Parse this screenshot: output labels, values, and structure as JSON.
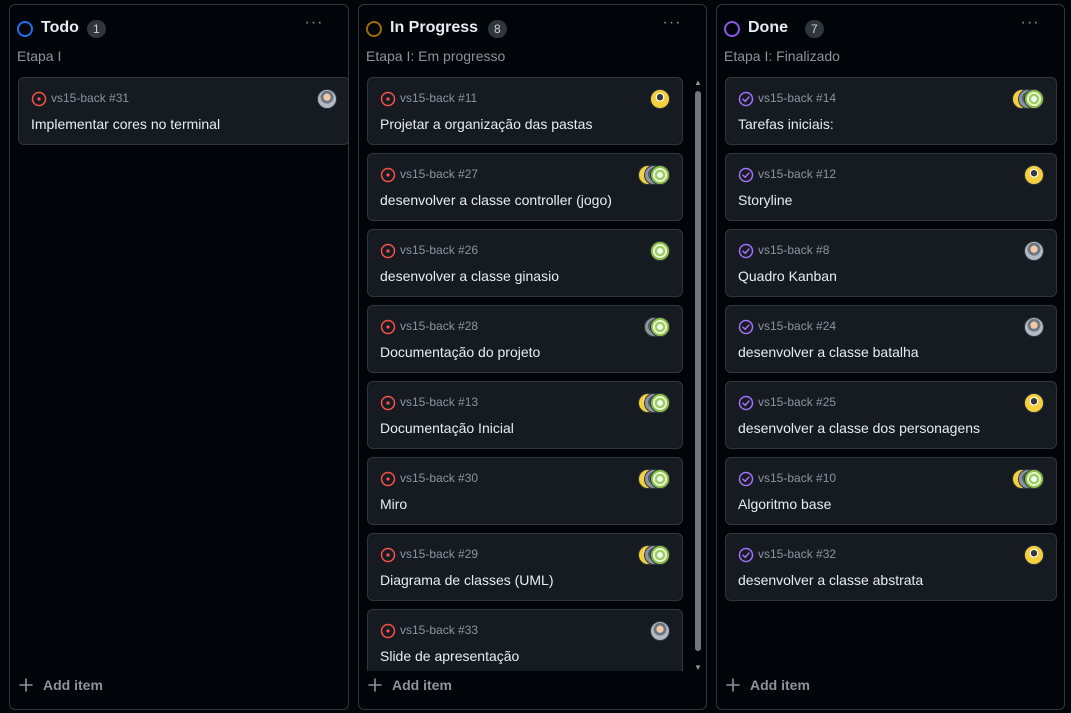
{
  "columns": [
    {
      "title": "Todo",
      "count": "1",
      "description": "Etapa I",
      "status_color": "#1f6feb",
      "add_label": "Add item",
      "cards": [
        {
          "ref": "vs15-back #31",
          "title": "Implementar cores no terminal",
          "state": "open",
          "avatars": [
            "photo"
          ]
        }
      ]
    },
    {
      "title": "In Progress",
      "count": "8",
      "description": "Etapa I: Em progresso",
      "status_color": "#9e6a03",
      "add_label": "Add item",
      "cards": [
        {
          "ref": "vs15-back #11",
          "title": "Projetar a organização das pastas",
          "state": "open",
          "avatars": [
            "yellow"
          ]
        },
        {
          "ref": "vs15-back #27",
          "title": "desenvolver a classe controller (jogo)",
          "state": "open",
          "avatars": [
            "yellow",
            "gray",
            "green"
          ]
        },
        {
          "ref": "vs15-back #26",
          "title": "desenvolver a classe ginasio",
          "state": "open",
          "avatars": [
            "green"
          ]
        },
        {
          "ref": "vs15-back #28",
          "title": "Documentação do projeto",
          "state": "open",
          "avatars": [
            "gray",
            "green"
          ]
        },
        {
          "ref": "vs15-back #13",
          "title": "Documentação Inicial",
          "state": "open",
          "avatars": [
            "yellow",
            "gray",
            "green"
          ]
        },
        {
          "ref": "vs15-back #30",
          "title": "Miro",
          "state": "open",
          "avatars": [
            "yellow",
            "gray",
            "green"
          ]
        },
        {
          "ref": "vs15-back #29",
          "title": "Diagrama de classes (UML)",
          "state": "open",
          "avatars": [
            "yellow",
            "gray",
            "green"
          ]
        },
        {
          "ref": "vs15-back #33",
          "title": "Slide de apresentação",
          "state": "open",
          "avatars": [
            "photo"
          ]
        }
      ]
    },
    {
      "title": "Done",
      "count": "7",
      "description": "Etapa I: Finalizado",
      "status_color": "#8957e5",
      "add_label": "Add item",
      "cards": [
        {
          "ref": "vs15-back #14",
          "title": "Tarefas iniciais:",
          "state": "done",
          "avatars": [
            "yellow",
            "gray",
            "green"
          ]
        },
        {
          "ref": "vs15-back #12",
          "title": "Storyline",
          "state": "done",
          "avatars": [
            "yellow"
          ]
        },
        {
          "ref": "vs15-back #8",
          "title": "Quadro Kanban",
          "state": "done",
          "avatars": [
            "photo"
          ]
        },
        {
          "ref": "vs15-back #24",
          "title": "desenvolver a classe batalha",
          "state": "done",
          "avatars": [
            "photo"
          ]
        },
        {
          "ref": "vs15-back #25",
          "title": "desenvolver a classe dos personagens",
          "state": "done",
          "avatars": [
            "yellow"
          ]
        },
        {
          "ref": "vs15-back #10",
          "title": "Algoritmo base",
          "state": "done",
          "avatars": [
            "yellow",
            "gray",
            "green"
          ]
        },
        {
          "ref": "vs15-back #32",
          "title": "desenvolver a classe abstrata",
          "state": "done",
          "avatars": [
            "yellow"
          ]
        }
      ]
    }
  ],
  "colors": {
    "open_issue": "#f85149",
    "done_issue": "#a371f7"
  },
  "icons": {
    "column_menu": "kebab-horizontal-icon",
    "add": "plus-icon",
    "open_issue": "issue-opened-icon",
    "done_issue": "issue-closed-icon"
  }
}
